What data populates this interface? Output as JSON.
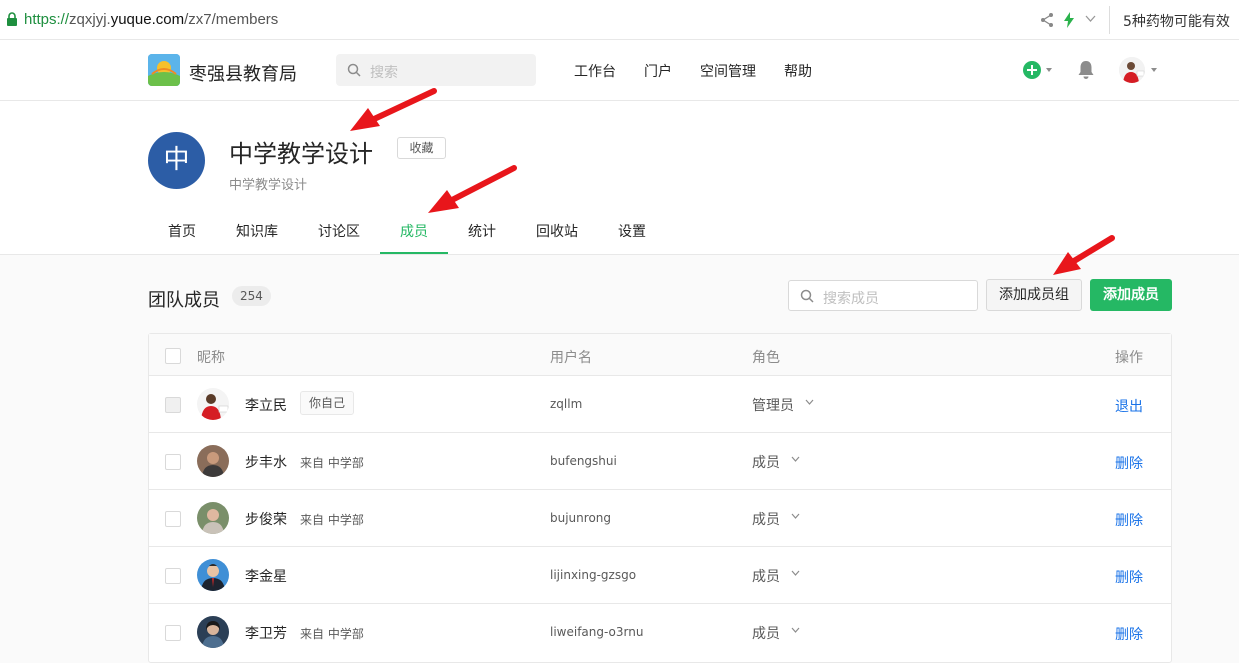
{
  "browser": {
    "url_proto": "https://",
    "url_host_prefix": "zqxjyj.",
    "url_host_main": "yuque.com",
    "url_path": "/zx7/members",
    "ad_text": "5种药物可能有效"
  },
  "topnav": {
    "org_name": "枣强县教育局",
    "search_placeholder": "搜索",
    "items": [
      "工作台",
      "门户",
      "空间管理",
      "帮助"
    ]
  },
  "space": {
    "avatar_char": "中",
    "title": "中学教学设计",
    "favorite_label": "收藏",
    "description": "中学教学设计",
    "tabs": [
      "首页",
      "知识库",
      "讨论区",
      "成员",
      "统计",
      "回收站",
      "设置"
    ],
    "active_tab": "成员"
  },
  "members": {
    "title": "团队成员",
    "count": "254",
    "search_placeholder": "搜索成员",
    "add_group_label": "添加成员组",
    "add_member_label": "添加成员",
    "columns": [
      "昵称",
      "用户名",
      "角色",
      "操作"
    ],
    "rows": [
      {
        "nick": "李立民",
        "tag": "你自己",
        "from": "",
        "username": "zqllm",
        "role": "管理员",
        "action": "退出"
      },
      {
        "nick": "步丰水",
        "tag": "",
        "from": "来自 中学部",
        "username": "bufengshui",
        "role": "成员",
        "action": "删除"
      },
      {
        "nick": "步俊荣",
        "tag": "",
        "from": "来自 中学部",
        "username": "bujunrong",
        "role": "成员",
        "action": "删除"
      },
      {
        "nick": "李金星",
        "tag": "",
        "from": "",
        "username": "lijinxing-gzsgo",
        "role": "成员",
        "action": "删除"
      },
      {
        "nick": "李卫芳",
        "tag": "",
        "from": "来自 中学部",
        "username": "liweifang-o3rnu",
        "role": "成员",
        "action": "删除"
      }
    ]
  },
  "colors": {
    "brand_green": "#25b864",
    "link_blue": "#1a73e8",
    "space_avatar_blue": "#2c5da6",
    "annotation_red": "#e8161b"
  }
}
